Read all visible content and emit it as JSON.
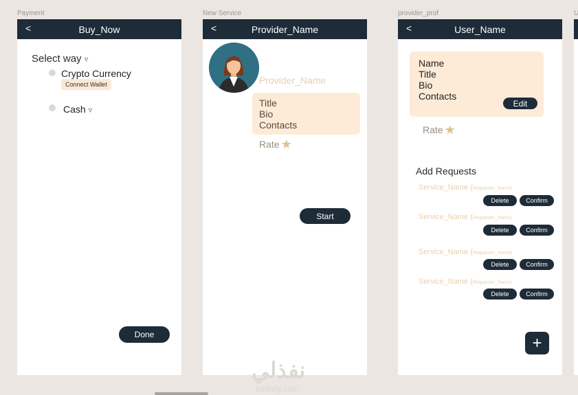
{
  "frames": {
    "payment": {
      "label": "Payment",
      "title": "Buy_Now",
      "back": "<",
      "select_way": "Select way",
      "options": [
        "Crypto Currency",
        "Cash"
      ],
      "connect_wallet": "Connect Wallet",
      "done": "Done"
    },
    "new_service": {
      "label": "New Service",
      "title": "Provider_Name",
      "back": "<",
      "provider_name": "Provider_Name",
      "card_lines": [
        "Title",
        "Bio",
        "Contacts"
      ],
      "rate": "Rate",
      "start": "Start"
    },
    "provider_prof": {
      "label": "provider_prof",
      "title": "User_Name",
      "back": "<",
      "card_lines": [
        "Name",
        "Title",
        "Bio",
        "Contacts"
      ],
      "edit": "Edit",
      "rate": "Rate",
      "add_requests": "Add Requests",
      "requests": [
        {
          "service": "Service_Name (",
          "requester": "Requester_Name)",
          "delete": "Delete",
          "confirm": "Confirm"
        },
        {
          "service": "Service_Name (",
          "requester": "Requester_Name)",
          "delete": "Delete",
          "confirm": "Confirm"
        },
        {
          "service": "Service_Name (",
          "requester": "Requester_Name)",
          "delete": "Delete",
          "confirm": "Confirm"
        },
        {
          "service": "Service_Name (",
          "requester": "Requester_Name)",
          "delete": "Delete",
          "confirm": "Confirm"
        }
      ],
      "add": "+"
    },
    "fourth": {
      "label": "U"
    }
  },
  "watermark": {
    "text": "نفذلي",
    "sub": "nafezly.com"
  },
  "icons": {
    "dropdown": "chevron-down-icon",
    "star": "star-icon",
    "plus": "plus-icon"
  },
  "colors": {
    "bar": "#1e2b38",
    "card": "#fdebd8",
    "accent": "#e2bf97",
    "canvas": "#ebe6e1"
  }
}
